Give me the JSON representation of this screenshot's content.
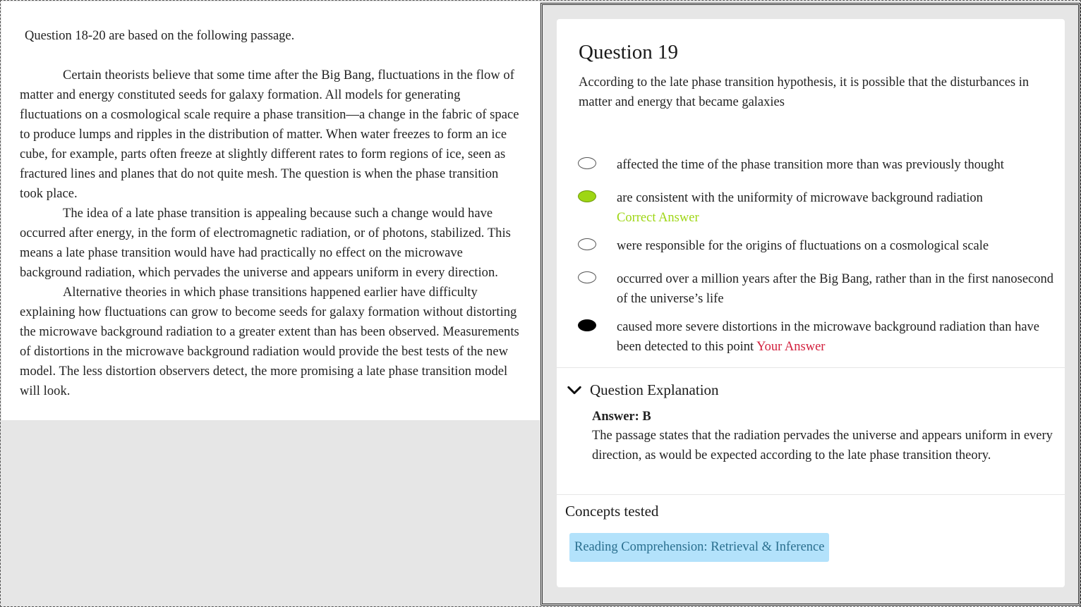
{
  "passage": {
    "intro": "Question 18-20 are based on the following passage.",
    "paragraphs": [
      "Certain theorists believe that some time after the Big Bang, fluctuations in the flow of matter and energy constituted seeds for galaxy formation. All models for generating fluctuations on a cosmological scale require a phase transition—a change in the fabric of space to produce lumps and ripples in the distribution of matter. When water freezes to form an ice cube, for example, parts often freeze at slightly different rates to form regions of ice, seen as fractured lines and planes that do not quite mesh. The question is when the phase transition took place.",
      "The idea of a late phase transition is appealing because such a change would have occurred after energy, in the form of electromagnetic radiation, or of photons, stabilized. This means a late phase transition would have had practically no effect on the microwave background radiation, which pervades the universe and appears uniform in every direction.",
      "Alternative theories in which phase transitions happened earlier have difficulty explaining how fluctuations can grow to become seeds for galaxy formation without distorting the microwave background radiation to a greater extent than has been observed. Measurements of distortions in the microwave background radiation would provide the best tests of the new model. The less distortion observers detect, the more promising a late phase transition model will look."
    ]
  },
  "question": {
    "title": "Question 19",
    "stem": "According to the late phase transition hypothesis, it is possible that the disturbances in matter and energy that became galaxies",
    "choices": [
      {
        "text": "affected the time of the phase transition more than was previously thought",
        "state": "none",
        "tag": ""
      },
      {
        "text": "are consistent with the uniformity of microwave background radiation",
        "state": "correct",
        "tag": "Correct Answer"
      },
      {
        "text": "were responsible for the origins of fluctuations on a cosmological scale",
        "state": "none",
        "tag": ""
      },
      {
        "text": "occurred over a million years after the Big Bang, rather than in the first nanosecond of the universe’s life",
        "state": "none",
        "tag": ""
      },
      {
        "text": "caused more severe distortions in the microwave background radiation than have been detected to this point",
        "state": "selected",
        "tag": "Your Answer"
      }
    ]
  },
  "explanation": {
    "header": "Question Explanation",
    "answer_label": "Answer: B",
    "body": "The passage states that the radiation pervades the universe and appears uniform in every direction, as would be expected according to the late phase transition theory."
  },
  "concepts": {
    "title": "Concepts tested",
    "items": [
      "Reading Comprehension: Retrieval & Inference"
    ]
  },
  "colors": {
    "correct": "#9ed614",
    "your_answer": "#d21f3c",
    "chip_bg": "#b3e2fb",
    "chip_text": "#2a6f8f"
  }
}
